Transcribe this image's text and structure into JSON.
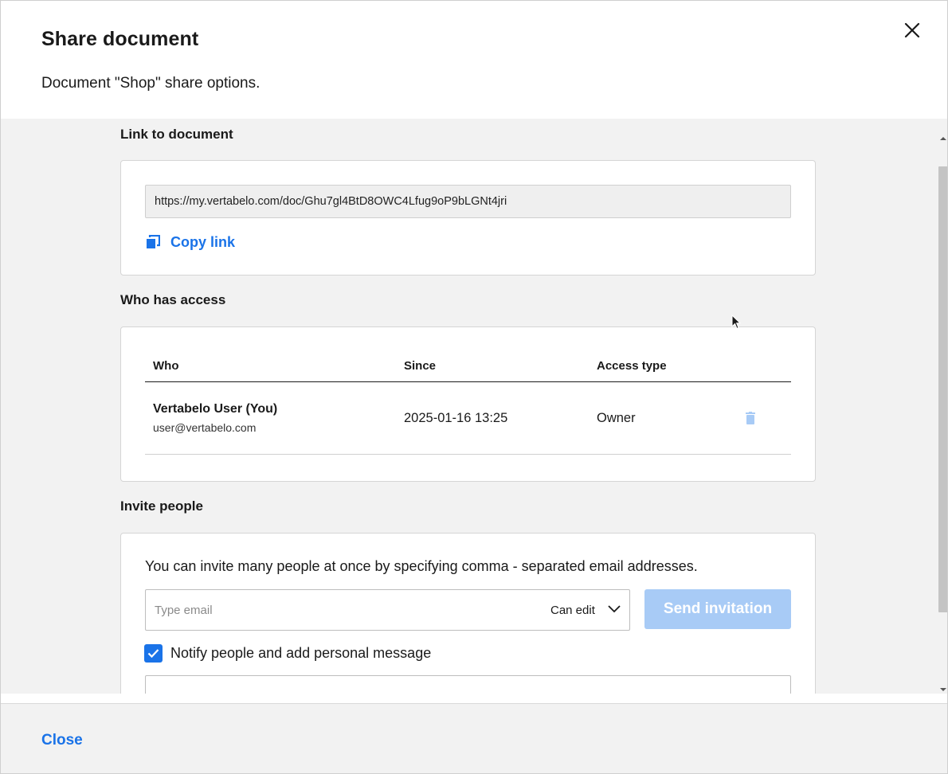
{
  "dialog": {
    "title": "Share document",
    "subtitle": "Document \"Shop\" share options."
  },
  "link_section": {
    "title": "Link to document",
    "url": "https://my.vertabelo.com/doc/Ghu7gl4BtD8OWC4Lfug9oP9bLGNt4jri",
    "copy_label": "Copy link"
  },
  "access_section": {
    "title": "Who has access",
    "columns": [
      "Who",
      "Since",
      "Access type"
    ],
    "rows": [
      {
        "name": "Vertabelo User (You)",
        "email": "user@vertabelo.com",
        "since": "2025-01-16 13:25",
        "access": "Owner"
      }
    ]
  },
  "invite_section": {
    "title": "Invite people",
    "hint": "You can invite many people at once by specifying comma - separated email addresses.",
    "email_placeholder": "Type email",
    "permission": "Can edit",
    "send_label": "Send invitation",
    "notify_label": "Notify people and add personal message",
    "notify_checked": true
  },
  "footer": {
    "close_label": "Close"
  },
  "colors": {
    "accent": "#1a73e8",
    "disabled_button": "#a8cbf6",
    "body_bg": "#f2f2f2"
  },
  "icons": {
    "close": "close-icon",
    "copy": "copy-icon",
    "trash": "trash-icon",
    "dropdown": "chevron-down-icon",
    "check": "check-icon"
  }
}
